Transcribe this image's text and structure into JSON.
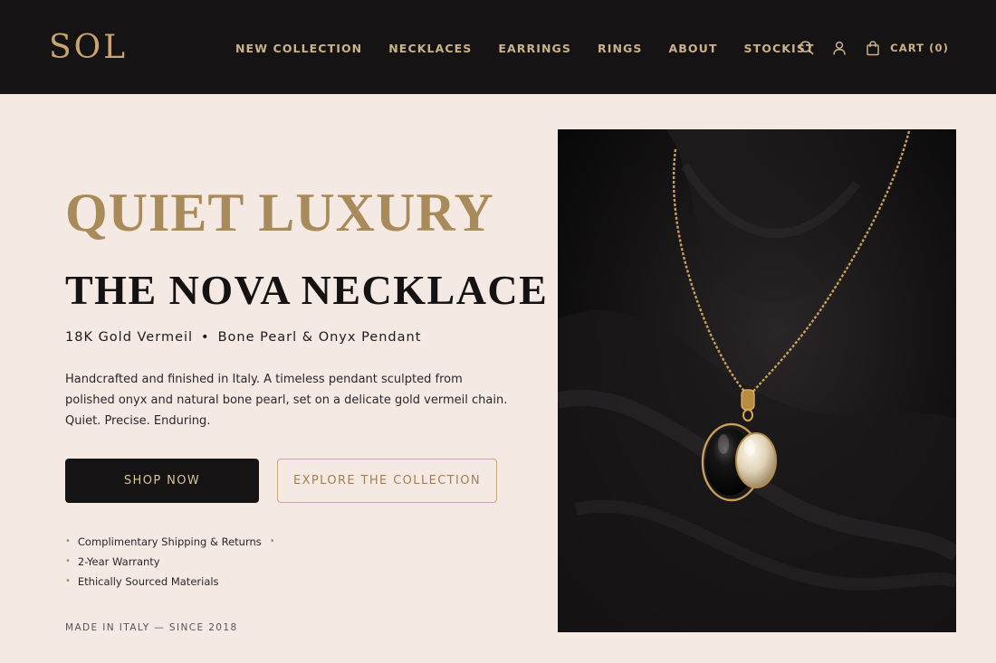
{
  "header": {
    "logo": "SOL",
    "nav": [
      "NEW COLLECTION",
      "NECKLACES",
      "EARRINGS",
      "RINGS",
      "ABOUT",
      "STOCKIST"
    ],
    "icons": [
      "search-icon",
      "account-icon",
      "bag-icon"
    ],
    "cart_label": "CART (0)"
  },
  "hero": {
    "eyebrow": "QUIET LUXURY",
    "title": "THE NOVA NECKLACE",
    "subtitle_a": "18K Gold Vermeil",
    "subtitle_sep": "•",
    "subtitle_b": "Bone Pearl & Onyx Pendant",
    "description": "Handcrafted and finished in Italy. A timeless pendant sculpted from polished onyx and natural bone pearl, set on a delicate gold vermeil chain. Quiet. Precise. Enduring.",
    "primary_button": "SHOP NOW",
    "secondary_button": "EXPLORE THE COLLECTION",
    "bullet": "•",
    "perks": [
      "Complimentary Shipping & Returns",
      "2-Year Warranty",
      "Ethically Sourced Materials"
    ],
    "footnote": "MADE IN ITALY — SINCE 2018"
  },
  "colors": {
    "background": "#f4e9e3",
    "header": "#151314",
    "gold": "#c9a46e",
    "accent": "#a98a5a"
  }
}
